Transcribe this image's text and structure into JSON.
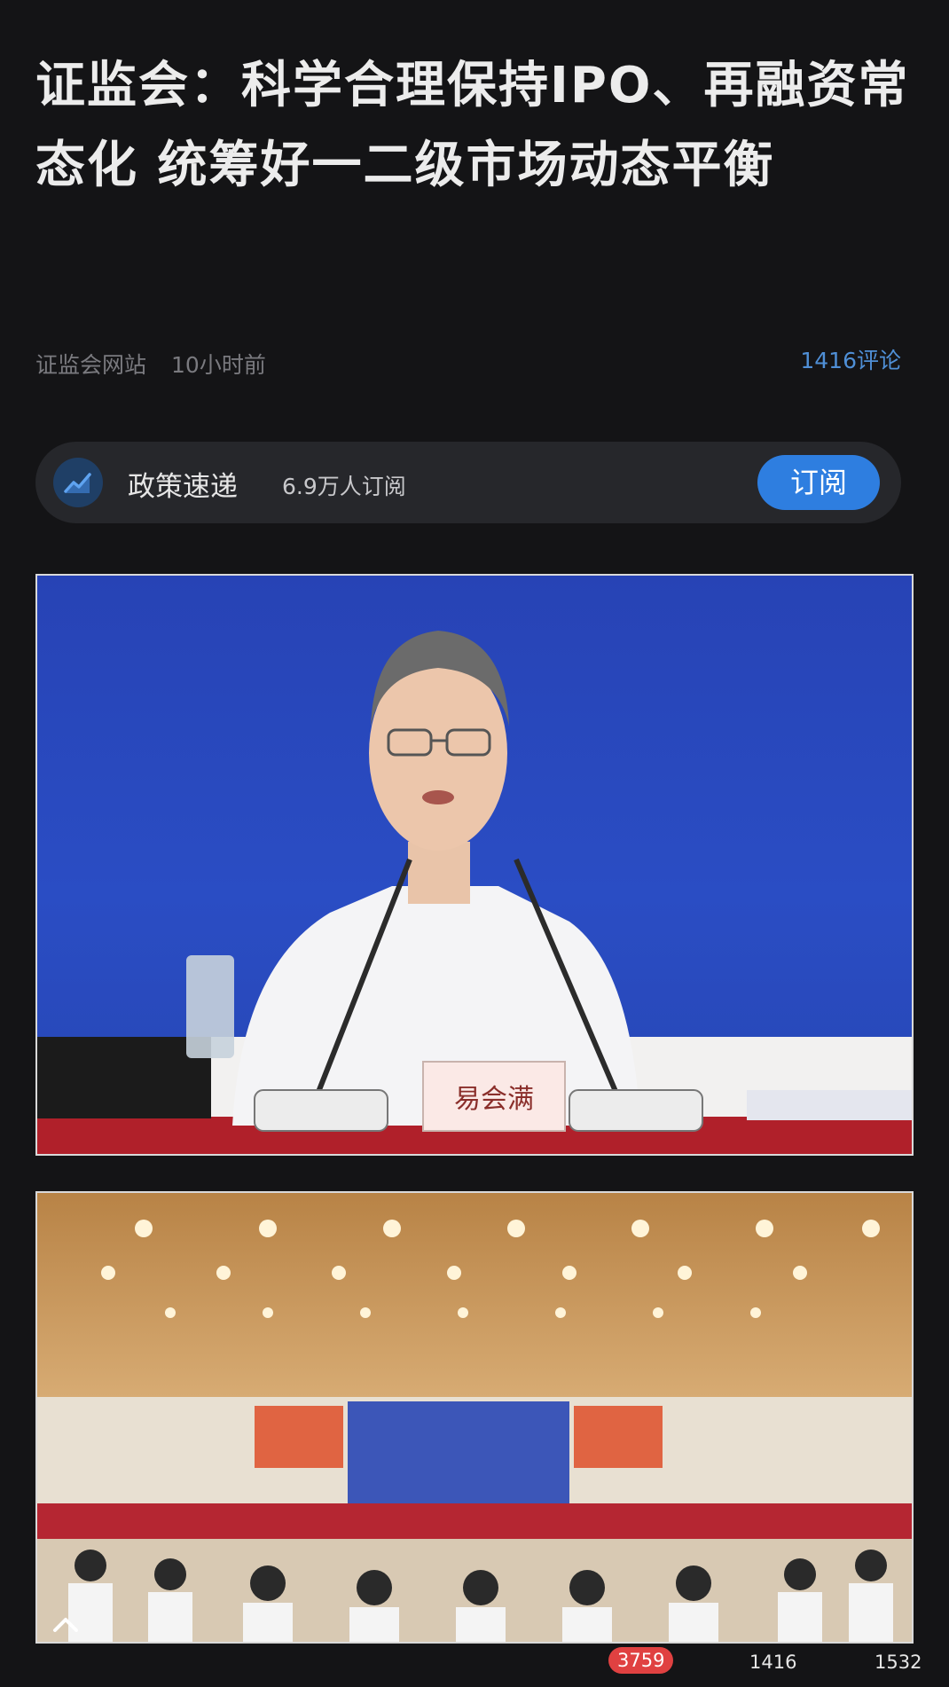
{
  "article": {
    "title": "证监会：科学合理保持IPO、再融资常态化 统筹好一二级市场动态平衡",
    "source": "证监会网站",
    "time": "10小时前",
    "comments_link": "1416评论"
  },
  "channel": {
    "icon": "trend-chart-icon",
    "name": "政策速递",
    "subscribers": "6.9万人订阅",
    "subscribe_label": "订阅"
  },
  "photo1": {
    "nameplate": "易会满"
  },
  "bottom": {
    "badge_count": "3759",
    "comment_count": "1416",
    "like_count": "1532"
  },
  "colors": {
    "background": "#141416",
    "accent": "#2e7ee0",
    "badge": "#e04141"
  }
}
